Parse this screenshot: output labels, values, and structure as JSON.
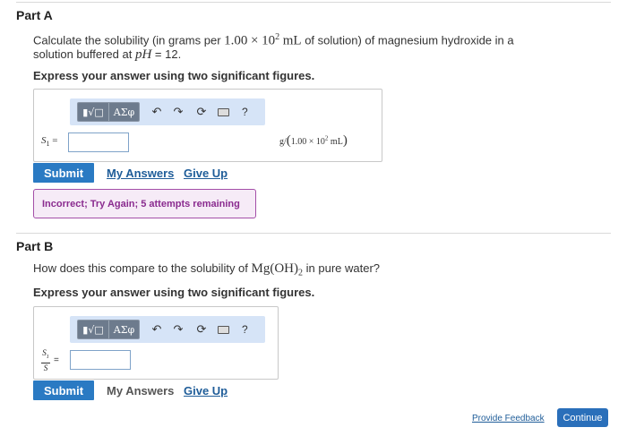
{
  "partA": {
    "title": "Part A",
    "question_pre": "Calculate the solubility (in grams per ",
    "q_num": "1.00",
    "q_times": "×",
    "q_base": "10",
    "q_exp": "2",
    "q_unit": "mL",
    "q_mid": " of solution) of magnesium hydroxide in a",
    "question_line2_pre": "solution buffered at ",
    "q_ph": "pH",
    "q_ph_value": " = 12.",
    "instruction": "Express your answer using two significant figures.",
    "toolbar": {
      "template_label": "▮√□",
      "symbols_label": "ΑΣφ",
      "undo_icon": "undo-icon",
      "redo_icon": "redo-icon",
      "reset_icon": "reset-icon",
      "keyboard_icon": "keyboard-icon",
      "help_label": "?"
    },
    "variable": "S",
    "variable_sub": "1",
    "equals": "=",
    "input_value": "",
    "unit_g": "g/",
    "unit_num": "1.00",
    "unit_times": "×",
    "unit_base": "10",
    "unit_exp": "2",
    "unit_ml": "mL",
    "submit_label": "Submit",
    "my_answers_label": "My Answers",
    "give_up_label": "Give Up",
    "feedback": "Incorrect; Try Again; 5 attempts remaining"
  },
  "partB": {
    "title": "Part B",
    "question_pre": "How does this compare to the solubility of ",
    "formula_main": "Mg(OH)",
    "formula_sub": "2",
    "question_post": " in pure water?",
    "instruction": "Express your answer using two significant figures.",
    "toolbar": {
      "template_label": "▮√□",
      "symbols_label": "ΑΣφ",
      "help_label": "?"
    },
    "frac_num": "S",
    "frac_num_sub": "1",
    "frac_den": "S",
    "equals": "=",
    "input_value": "",
    "submit_label": "Submit",
    "my_answers_label": "My Answers",
    "give_up_label": "Give Up"
  },
  "footer": {
    "provide_feedback_label": "Provide Feedback",
    "continue_label": "Continue"
  },
  "colors": {
    "accent": "#2a7ac3",
    "toolbar_bg": "#d6e4f7",
    "feedback_border": "#a44fa8",
    "feedback_text": "#8a2b8f"
  }
}
